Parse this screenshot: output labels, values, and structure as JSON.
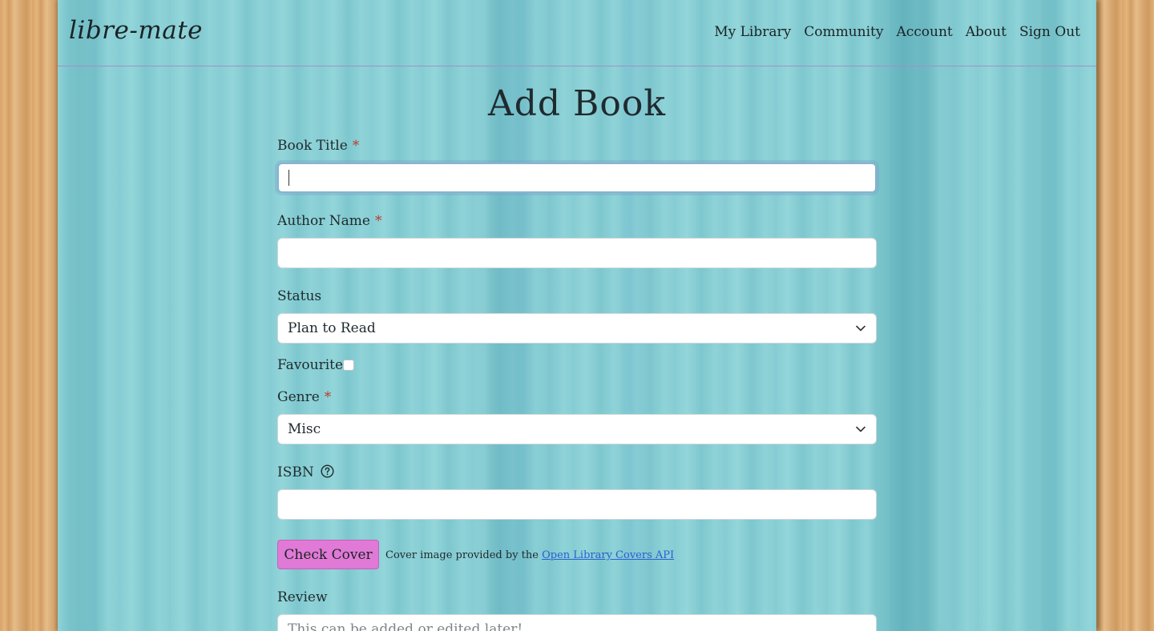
{
  "navbar": {
    "brand": "libre-mate",
    "links": [
      "My Library",
      "Community",
      "Account",
      "About",
      "Sign Out"
    ]
  },
  "page": {
    "title": "Add Book"
  },
  "form": {
    "book_title": {
      "label": "Book Title",
      "required_mark": "*",
      "value": ""
    },
    "author_name": {
      "label": "Author Name",
      "required_mark": "*",
      "value": ""
    },
    "status": {
      "label": "Status",
      "selected": "Plan to Read"
    },
    "favourite": {
      "label": "Favourite",
      "checked": false
    },
    "genre": {
      "label": "Genre",
      "required_mark": "*",
      "selected": "Misc"
    },
    "isbn": {
      "label": "ISBN",
      "help_icon": "question-circle-icon",
      "value": ""
    },
    "check_cover": {
      "button_label": "Check Cover",
      "note_prefix": "Cover image provided by the",
      "note_link": "Open Library Covers API"
    },
    "review": {
      "label": "Review",
      "placeholder": "This can be added or edited later!"
    }
  },
  "colors": {
    "panel_teal": "#8bd1d6",
    "wood": "#dcaa70",
    "button_pink": "#e07ad6",
    "required_red": "#c0392b",
    "link_blue": "#2a5fd0",
    "nav_divider": "#a58fc8"
  }
}
